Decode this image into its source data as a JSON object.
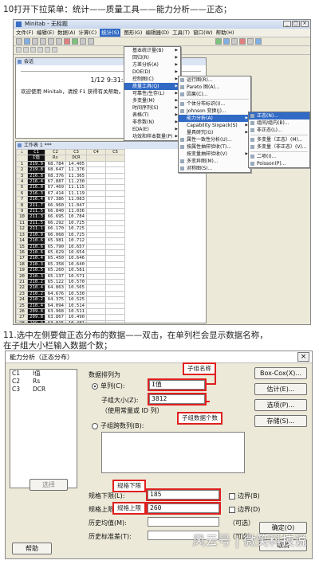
{
  "step10": "10打开下拉菜单：统计——质量工具——能力分析——正态；",
  "step11_line1": "11.选中左侧要做正态分布的数据——双击，在单列栏会显示数据名称，",
  "step11_line2": "在子组大小栏输入数据个数；",
  "app": {
    "title": "Minitab - 无标题",
    "menubar": [
      "文件(F)",
      "编辑(E)",
      "数据(A)",
      "计算(C)",
      "统计(S)",
      "图形(G)",
      "编辑器(D)",
      "工具(T)",
      "窗口(W)",
      "帮助(H)"
    ],
    "session_title": "会话",
    "session_stamp": "1/12 9:31:00",
    "session_welcome": "欢迎使用 Minitab，请按 F1 获得有关帮助。",
    "worksheet_title": "工作表 1 ***",
    "stat_menu": [
      "基本统计量(B)",
      "回归(R)",
      "方差分析(A)",
      "DOE(D)",
      "控制图(C)",
      "质量工具(Q)",
      "可靠性/生存(L)",
      "多变量(M)",
      "时间序列(S)",
      "表格(T)",
      "非参数(N)",
      "EDA(E)",
      "功效和样本数量(P)"
    ],
    "quality_menu": [
      "运行图(R)...",
      "Pareto 图(A)...",
      "因果(C)...",
      "个体分布标识(I)...",
      "Johnson 变换(J)...",
      "能力分析(A)",
      "Capability Sixpack(S)",
      "量具研究(G)",
      "属性一致性分析(U)...",
      "按属性抽样验收(T)...",
      "按变量抽样验收(V)",
      "多变异图(M)...",
      "对称图(S)..."
    ],
    "capability_menu": [
      "正态(N)...",
      "组间/组内(B)...",
      "非正态(L)...",
      "多变量（正态）(M)...",
      "多变量（非正态）(V)...",
      "二项(I)...",
      "Poisson(P)..."
    ],
    "columns": [
      "C1",
      "C2",
      "C3",
      "C4",
      "C5"
    ],
    "column_names": [
      "I值",
      "Rs",
      "DCR",
      "",
      ""
    ],
    "rows": [
      [
        "219.9",
        "68.784",
        "14.405"
      ],
      [
        "219.8",
        "68.647",
        "11.376"
      ],
      [
        "216.8",
        "68.376",
        "11.365"
      ],
      [
        "216.4",
        "67.887",
        "11.230"
      ],
      [
        "216.0",
        "67.469",
        "11.115"
      ],
      [
        "216.3",
        "67.414",
        "11.119"
      ],
      [
        "216.4",
        "67.386",
        "11.083"
      ],
      [
        "211.7",
        "66.960",
        "11.047"
      ],
      [
        "211.5",
        "66.840",
        "11.036"
      ],
      [
        "211.3",
        "66.695",
        "10.784"
      ],
      [
        "211.5",
        "66.292",
        "10.725"
      ],
      [
        "211.1",
        "66.170",
        "10.725"
      ],
      [
        "210.9",
        "66.068",
        "10.725"
      ],
      [
        "210.6",
        "65.981",
        "10.712"
      ],
      [
        "210.6",
        "65.790",
        "10.657"
      ],
      [
        "210.6",
        "65.629",
        "10.654"
      ],
      [
        "210.4",
        "65.450",
        "10.646"
      ],
      [
        "210.3",
        "65.358",
        "10.640"
      ],
      [
        "210.5",
        "65.260",
        "10.581"
      ],
      [
        "210.3",
        "65.137",
        "10.571"
      ],
      [
        "210.2",
        "65.122",
        "10.570"
      ],
      [
        "210.4",
        "64.863",
        "10.565"
      ],
      [
        "210.2",
        "64.676",
        "10.530"
      ],
      [
        "210.2",
        "64.375",
        "10.525"
      ],
      [
        "210.4",
        "64.094",
        "10.514"
      ],
      [
        "209.8",
        "63.968",
        "10.511"
      ],
      [
        "209.8",
        "63.867",
        "10.490"
      ],
      [
        "209.9",
        "63.815",
        "10.481"
      ],
      [
        "209.8",
        "63.733",
        "10.481"
      ],
      [
        "209.7",
        "63.575",
        "10.474"
      ]
    ]
  },
  "dialog": {
    "title": "能力分析（正态分布）",
    "variables": [
      [
        "C1",
        "I值"
      ],
      [
        "C2",
        "Rs"
      ],
      [
        "C3",
        "DCR"
      ]
    ],
    "data_label": "数据排列为",
    "single_column_label": "单列(C):",
    "single_column_value": "I值",
    "subgroup_label": "子组大小(Z):",
    "subgroup_value": "3812",
    "subgroup_hint": "（使用常量或 ID 列）",
    "across_rows_label": "子组跨数列(B):",
    "lsl_label": "规格下限(L):",
    "lsl_value": "185",
    "usl_label": "规格上限(U):",
    "usl_value": "260",
    "boundary_lower": "边界(B)",
    "boundary_upper": "边界(D)",
    "hist_mean_label": "历史均值(M):",
    "hist_sd_label": "历史标准差(T):",
    "optional": "（可选）",
    "btn_boxcox": "Box-Cox(X)...",
    "btn_estimate": "估计(E)...",
    "btn_options": "选项(P)...",
    "btn_storage": "存储(S)...",
    "btn_select": "选择",
    "btn_help": "帮助",
    "btn_ok": "确定(O)",
    "btn_cancel": "取消",
    "callout_subgroup_name": "子组名称",
    "callout_subgroup_count": "子组数据个数",
    "callout_lsl": "规格下限",
    "callout_usl": "规格上限"
  },
  "watermark": "风云号 | 微笑科技说"
}
